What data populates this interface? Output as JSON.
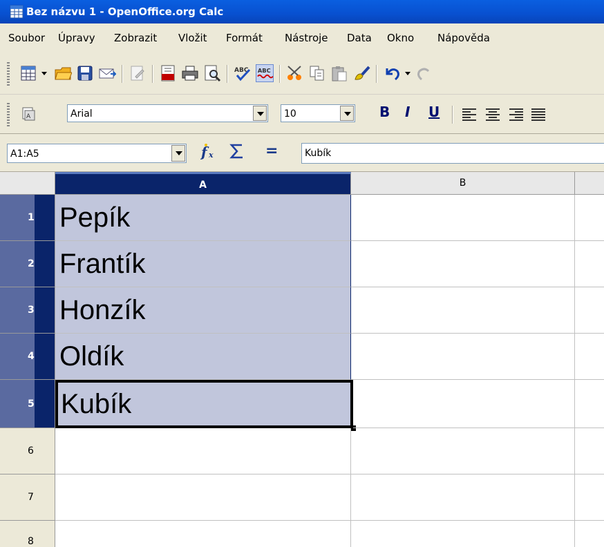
{
  "window": {
    "title": "Bez názvu 1 - OpenOffice.org Calc"
  },
  "menu": [
    {
      "label": "Soubor"
    },
    {
      "label": "Úpravy"
    },
    {
      "label": "Zobrazit"
    },
    {
      "label": "Vložit"
    },
    {
      "label": "Formát"
    },
    {
      "label": "Nástroje"
    },
    {
      "label": "Data"
    },
    {
      "label": "Okno"
    },
    {
      "label": "Nápověda"
    }
  ],
  "formatting": {
    "font_name": "Arial",
    "font_size": "10",
    "bold_label": "B",
    "italic_label": "I",
    "underline_label": "U"
  },
  "formula_bar": {
    "name_box": "A1:A5",
    "content": "Kubík",
    "equals_label": "="
  },
  "sheet": {
    "columns": [
      "A",
      "B"
    ],
    "rows": [
      {
        "number": "1",
        "a": "Pepík"
      },
      {
        "number": "2",
        "a": "Frantík"
      },
      {
        "number": "3",
        "a": "Honzík"
      },
      {
        "number": "4",
        "a": "Oldík"
      },
      {
        "number": "5",
        "a": "Kubík"
      },
      {
        "number": "6",
        "a": ""
      },
      {
        "number": "7",
        "a": ""
      },
      {
        "number": "8",
        "a": ""
      }
    ],
    "selection": "A1:A5",
    "active_cell": "A5"
  },
  "colors": {
    "title_bar": "#0a5fe0",
    "selection_fill": "#c1c6dc",
    "selected_header": "#0a246a"
  }
}
